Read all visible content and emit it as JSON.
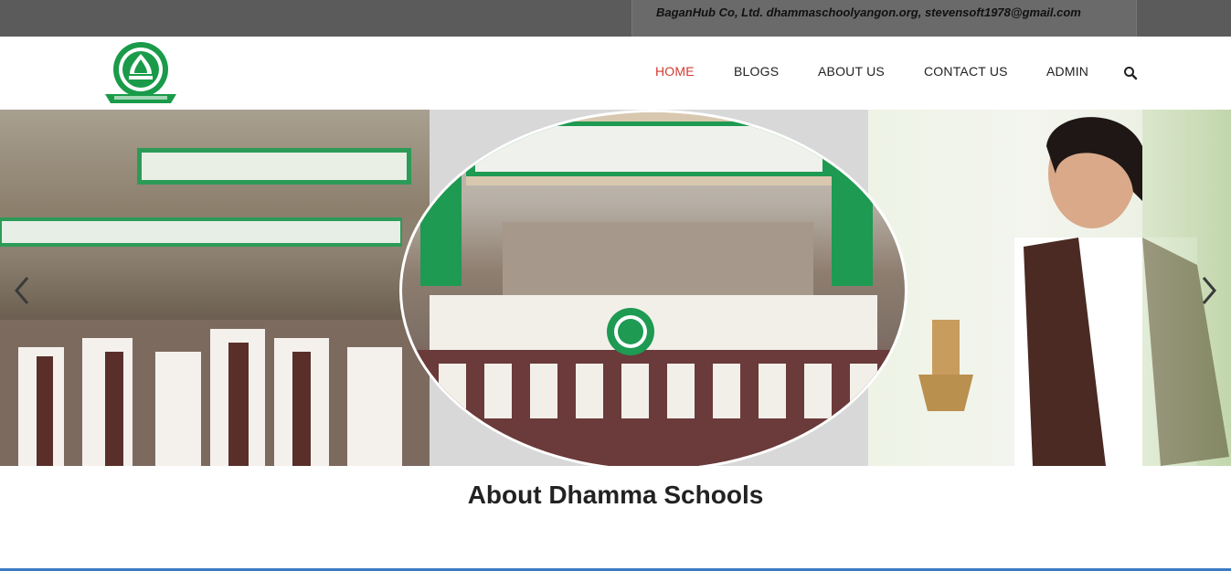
{
  "topbar": {
    "contact_text": "BaganHub Co, Ltd. dhammaschoolyangon.org, stevensoft1978@gmail.com"
  },
  "header": {
    "logo_icon": "dhamma-school-logo",
    "nav": [
      {
        "label": "HOME",
        "active": true
      },
      {
        "label": "BLOGS",
        "active": false
      },
      {
        "label": "ABOUT US",
        "active": false
      },
      {
        "label": "CONTACT US",
        "active": false
      },
      {
        "label": "ADMIN",
        "active": false
      }
    ],
    "search_icon": "search-icon"
  },
  "slider": {
    "slides": [
      "students-outdoors-photo",
      "school-group-photo",
      "teacher-with-bell-photo"
    ],
    "prev_icon": "chevron-left-icon",
    "next_icon": "chevron-right-icon"
  },
  "about": {
    "title": "About Dhamma Schools"
  },
  "colors": {
    "brand_green": "#1a9b4a",
    "active_nav": "#d23b30",
    "topbar": "#5b5b5b"
  }
}
